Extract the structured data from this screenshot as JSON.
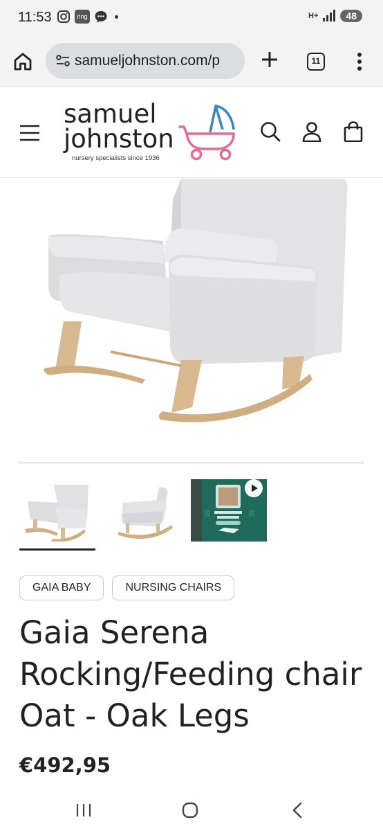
{
  "status_bar": {
    "time": "11:53",
    "ring_label": "ring",
    "network": "H+",
    "battery": "48"
  },
  "browser": {
    "url": "samueljohnston.com/p",
    "tab_count": "11"
  },
  "site": {
    "logo_line1": "samuel",
    "logo_line2": "johnston",
    "logo_tagline": "nursery specialists since 1936",
    "brand_pink": "#e86a8f",
    "brand_blue": "#3b84c4"
  },
  "product": {
    "tags": [
      "GAIA BABY",
      "NURSING CHAIRS"
    ],
    "title": "Gaia Serena Rocking/Feeding chair Oat - Oak Legs",
    "price": "€492,95",
    "thumbnails": [
      "chair-front-view",
      "chair-side-view",
      "video-thumbnail"
    ]
  }
}
